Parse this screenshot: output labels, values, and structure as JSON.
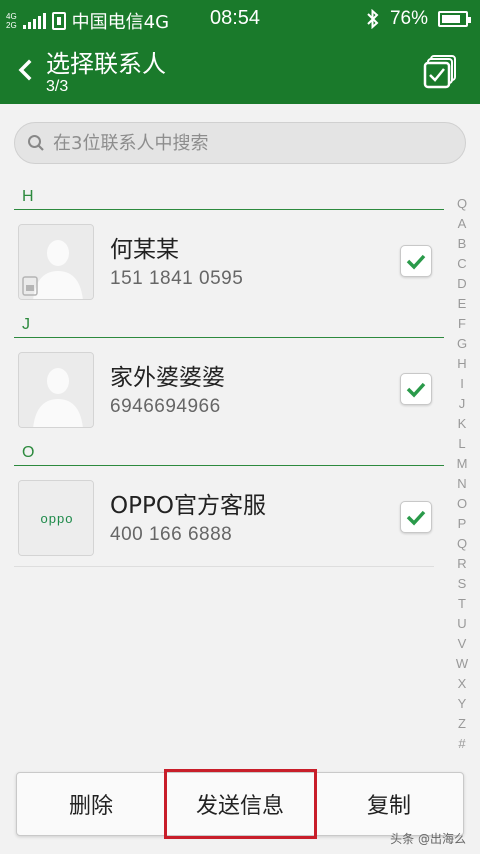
{
  "status_bar": {
    "network_top": "4G",
    "network_bottom": "2G",
    "carrier": "中国电信4G",
    "time": "08:54",
    "battery": "76%",
    "icons": [
      "signal-icon",
      "sim-icon",
      "bluetooth-icon",
      "battery-icon"
    ]
  },
  "header": {
    "title": "选择联系人",
    "subtitle": "3/3",
    "back_icon": "back-chevron-icon",
    "select_all_icon": "select-all-icon"
  },
  "search": {
    "placeholder": "在3位联系人中搜索",
    "icon": "search-icon"
  },
  "sections": [
    {
      "letter": "H",
      "contacts": [
        {
          "name": "何某某",
          "phone": "151 1841 0595",
          "checked": true,
          "avatar": "default-avatar-sim"
        }
      ]
    },
    {
      "letter": "J",
      "contacts": [
        {
          "name": "家外婆婆婆",
          "phone": "6946694966",
          "checked": true,
          "avatar": "default-avatar"
        }
      ]
    },
    {
      "letter": "O",
      "contacts": [
        {
          "name": "OPPO官方客服",
          "phone": "400 166 6888",
          "checked": true,
          "avatar": "oppo-logo"
        }
      ]
    }
  ],
  "oppo_logo_text": "oppo",
  "index_letters": [
    "Q",
    "A",
    "B",
    "C",
    "D",
    "E",
    "F",
    "G",
    "H",
    "I",
    "J",
    "K",
    "L",
    "M",
    "N",
    "O",
    "P",
    "Q",
    "R",
    "S",
    "T",
    "U",
    "V",
    "W",
    "X",
    "Y",
    "Z",
    "#"
  ],
  "bottom_bar": {
    "delete_label": "删除",
    "send_label": "发送信息",
    "copy_label": "复制"
  },
  "watermark": "头条 @出海么",
  "colors": {
    "header_green": "#1a7a2b",
    "section_green": "#2d8a3e",
    "check_green": "#2a9a4a",
    "highlight_red": "#c81e2a"
  }
}
